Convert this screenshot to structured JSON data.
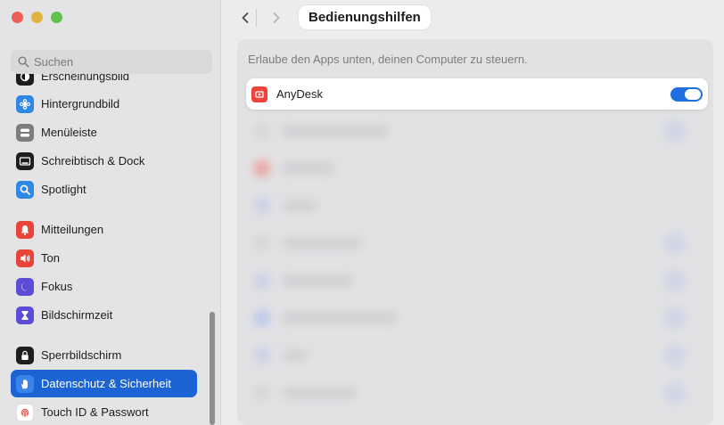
{
  "window": {
    "traffic_lights": {
      "close": "#ec5f57",
      "minimize": "#e0b33f",
      "zoom": "#5fc24e"
    }
  },
  "sidebar": {
    "search_placeholder": "Suchen",
    "items": [
      {
        "label": "Erscheinungsbild",
        "icon": "appearance-icon",
        "color": "#1d1d1f"
      },
      {
        "label": "Hintergrundbild",
        "icon": "wallpaper-icon",
        "color": "#2f87e6"
      },
      {
        "label": "Menüleiste",
        "icon": "menubar-icon",
        "color": "#7d7d80"
      },
      {
        "label": "Schreibtisch & Dock",
        "icon": "dock-icon",
        "color": "#1d1d1f"
      },
      {
        "label": "Spotlight",
        "icon": "spotlight-icon",
        "color": "#2f87e6"
      },
      {
        "label": "Mitteilungen",
        "icon": "notifications-icon",
        "color": "#e8443a"
      },
      {
        "label": "Ton",
        "icon": "sound-icon",
        "color": "#e8443a"
      },
      {
        "label": "Fokus",
        "icon": "focus-icon",
        "color": "#5b4bd6"
      },
      {
        "label": "Bildschirmzeit",
        "icon": "screentime-icon",
        "color": "#5b4bd6"
      },
      {
        "label": "Sperrbildschirm",
        "icon": "lock-icon",
        "color": "#1d1d1f"
      },
      {
        "label": "Datenschutz & Sicherheit",
        "icon": "privacy-hand-icon",
        "color": "#3b82ea",
        "active": true
      },
      {
        "label": "Touch ID & Passwort",
        "icon": "fingerprint-icon",
        "color": "#ffffff"
      }
    ]
  },
  "toolbar": {
    "title": "Bedienungshilfen"
  },
  "content": {
    "description": "Erlaube den Apps unten, deinen Computer zu steuern.",
    "app": {
      "name": "AnyDesk",
      "enabled": true,
      "accent": "#1f6fe3"
    }
  }
}
